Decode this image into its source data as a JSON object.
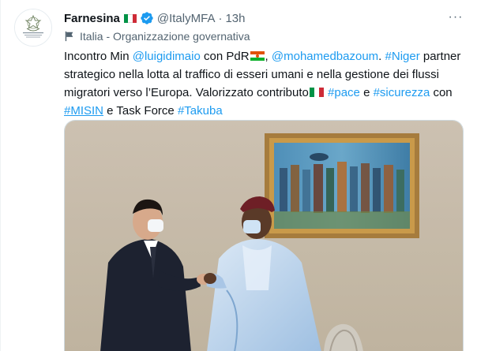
{
  "account": {
    "name": "Farnesina",
    "handle": "@ItalyMFA",
    "separator": "·",
    "time": "13h",
    "avatar_icon": "italian-republic-emblem-icon",
    "verified_icon": "verified-badge-icon",
    "more_icon": "more-options-icon",
    "more_label": "···"
  },
  "label": {
    "icon": "flag-icon",
    "text": "Italia - Organizzazione governativa"
  },
  "tweet": {
    "seg1": "Incontro Min ",
    "mention1": "@luigidimaio",
    "seg2": " con PdR",
    "seg3": ", ",
    "mention2": "@mohamedbazoum",
    "seg4": ". ",
    "hashtag_niger": "#Niger",
    "seg5": " partner strategico nella lotta al traffico di esseri umani e nella gestione dei flussi migratori verso l’Europa. Valorizzato contributo",
    "seg6": " ",
    "hashtag_pace": "#pace",
    "seg7": " e ",
    "hashtag_sicurezza": "#sicurezza",
    "seg8": " con",
    "hashtag_misin": "#MISIN",
    "seg9": " e Task Force ",
    "hashtag_takuba": "#Takuba"
  },
  "media": {
    "icon": "photo-image"
  },
  "colors": {
    "link": "#1d9bf0",
    "secondary_text": "#536471",
    "verified": "#1d9bf0",
    "italy_green": "#009246",
    "italy_white": "#ffffff",
    "italy_red": "#ce2b37",
    "niger_orange": "#e05206",
    "niger_green": "#0db02b"
  }
}
